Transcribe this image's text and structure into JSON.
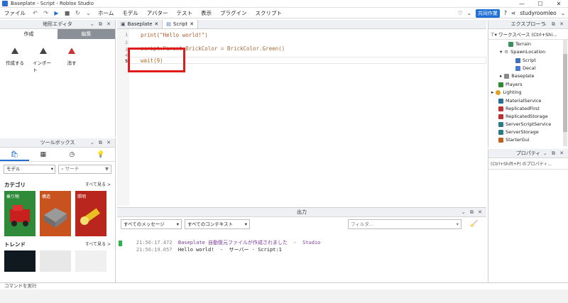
{
  "window": {
    "title": "Baseplate - Script - Roblox Studio",
    "min": "—",
    "max": "☐",
    "close": "✕"
  },
  "menu": {
    "items": [
      "ファイル",
      "ホーム",
      "モデル",
      "アバター",
      "テスト",
      "表示",
      "プラグイン",
      "スクリプト"
    ],
    "collab_label": "共同作業",
    "user": "studyroomleo"
  },
  "terrain": {
    "title": "地形エディタ",
    "tab_create": "作成",
    "tab_edit": "編集",
    "tools": [
      {
        "label": "作成する",
        "icon": "terrain-generate-icon"
      },
      {
        "label": "インポート",
        "icon": "terrain-import-icon"
      },
      {
        "label": "消す",
        "icon": "terrain-clear-icon"
      }
    ]
  },
  "toolbox": {
    "title": "ツールボックス",
    "filter_category": "モデル",
    "search_placeholder": "サーチ",
    "section_category": "カテゴリ",
    "section_trend": "トレンド",
    "see_all": "すべて見る >",
    "cards": [
      {
        "label": "乗り物",
        "color": "#2f8a3a"
      },
      {
        "label": "構造",
        "color": "#c9531e"
      },
      {
        "label": "照明",
        "color": "#b8261d"
      }
    ]
  },
  "editor": {
    "tabs": [
      {
        "label": "Baseplate",
        "active": false
      },
      {
        "label": "Script",
        "active": true
      }
    ],
    "lines": [
      {
        "no": "1",
        "text": "print(\"Hello world!\")"
      },
      {
        "no": "2",
        "text": ""
      },
      {
        "no": "3",
        "text": "script.Parent.BrickColor = BrickColor.Green()"
      },
      {
        "no": "4",
        "text": ""
      },
      {
        "no": "5",
        "text": "wait(9)"
      }
    ]
  },
  "output": {
    "title": "出力",
    "messages_filter": "すべてのメッセージ",
    "context_filter": "すべてのコンテキスト",
    "filter_placeholder": "フィルタ...",
    "rows": [
      {
        "time": "21:56:17.472",
        "text": "Baseplate 自動復元ファイルが作成されました  -  Studio"
      },
      {
        "time": "21:56:19.057",
        "text": "Hello world!  -  サーバー - Script:1"
      }
    ]
  },
  "explorer": {
    "title": "エクスプローラ",
    "workspace": "ワークスペース (Ctrl+Shi...",
    "nodes": [
      {
        "label": "Terrain",
        "color": "#3a8f5a"
      },
      {
        "label": "SpawnLocation",
        "color": "#666666"
      },
      {
        "label": "Script",
        "color": "#3f6fbf"
      },
      {
        "label": "Decal",
        "color": "#4a7ad0"
      },
      {
        "label": "Baseplate",
        "color": "#8a8a8a"
      },
      {
        "label": "Players",
        "color": "#2e8a2e"
      },
      {
        "label": "Lighting",
        "color": "#e0a020"
      },
      {
        "label": "MaterialService",
        "color": "#2a6f9a"
      },
      {
        "label": "ReplicatedFirst",
        "color": "#c03030"
      },
      {
        "label": "ReplicatedStorage",
        "color": "#c03030"
      },
      {
        "label": "ServerScriptService",
        "color": "#2a7a8a"
      },
      {
        "label": "ServerStorage",
        "color": "#2a7a8a"
      },
      {
        "label": "StarterGui",
        "color": "#c06020"
      }
    ]
  },
  "properties": {
    "title": "プロパティ",
    "filter": "(Ctrl+Shift+P) のプロパティ..."
  },
  "command": {
    "placeholder": "コマンドを実行"
  }
}
